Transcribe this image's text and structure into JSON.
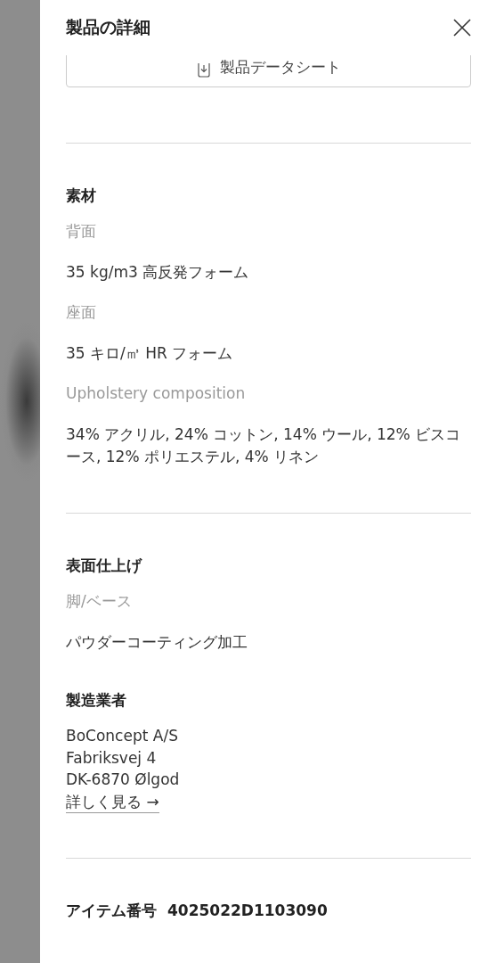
{
  "panel": {
    "title": "製品の詳細",
    "datasheet_button": "製品データシート"
  },
  "groups": [
    [
      {
        "kind": "spec",
        "heading": "素材",
        "rows": [
          {
            "label": "背面",
            "value": "35 kg/m3 高反発フォーム"
          },
          {
            "label": "座面",
            "value": "35 キロ/㎥ HR フォーム"
          },
          {
            "label": "Upholstery composition",
            "value": "34% アクリル, 24%  コットン, 14% ウール, 12% ビスコース, 12% ポリエステル, 4% リネン"
          }
        ]
      }
    ],
    [
      {
        "kind": "spec",
        "heading": "表面仕上げ",
        "rows": [
          {
            "label": "脚/ベース",
            "value": "パウダーコーティング加工"
          }
        ]
      },
      {
        "kind": "address",
        "heading": "製造業者",
        "lines": [
          "BoConcept A/S",
          "Fabriksvej 4",
          "DK-6870 Ølgod"
        ],
        "link": "詳しく見る →"
      }
    ],
    [
      {
        "kind": "item",
        "label": "アイテム番号",
        "value": "4025022D1103090"
      }
    ]
  ]
}
